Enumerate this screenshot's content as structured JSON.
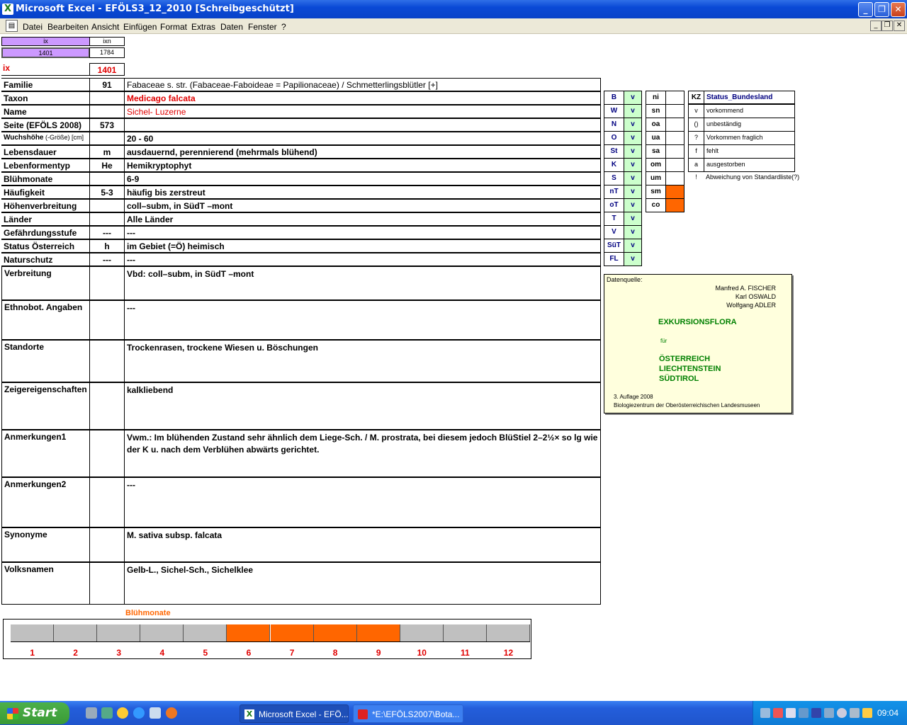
{
  "window": {
    "title": "Microsoft Excel - EFÖLS3_12_2010  [Schreibgeschützt]"
  },
  "menu": {
    "items": [
      "Datei",
      "Bearbeiten",
      "Ansicht",
      "Einfügen",
      "Format",
      "Extras",
      "Daten",
      "Fenster",
      "?"
    ]
  },
  "index": {
    "hdr_ix": "ix",
    "hdr_ixn": "ixn",
    "ix_val": "1401",
    "ixn_val": "1784",
    "ix_label": "ix",
    "ix_big": "1401"
  },
  "fields": [
    {
      "label": "Familie",
      "code": "91",
      "value": "Fabaceae s. str. (Fabaceae-Faboideae = Papilionaceae)  /  Schmetterlingsblütler [+]"
    },
    {
      "label": "Taxon",
      "code": "",
      "value": "Medicago falcata"
    },
    {
      "label": "Name",
      "code": "",
      "value": "Sichel- Luzerne"
    },
    {
      "label": "Seite (EFÖLS 2008)",
      "code": "573",
      "value": ""
    },
    {
      "label": "Wuchshöhe",
      "label_small": " (-Größe) [cm]",
      "code": "",
      "value": " 20 - 60"
    },
    {
      "label": "Lebensdauer",
      "code": "m",
      "value": "ausdauernd, perennierend (mehrmals blühend)"
    },
    {
      "label": "Lebenformentyp",
      "code": "He",
      "value": "Hemikryptophyt"
    },
    {
      "label": "Blühmonate",
      "code": "",
      "value": " 6-9"
    },
    {
      "label": "Häufigkeit",
      "code": "5-3",
      "value": "häufig bis zerstreut"
    },
    {
      "label": "Höhenverbreitung",
      "code": "",
      "value": "coll–subm, in SüdT –mont"
    },
    {
      "label": "Länder",
      "code": "",
      "value": "Alle Länder"
    },
    {
      "label": "Gefährdungsstufe",
      "code": "---",
      "value": "  ---"
    },
    {
      "label": "Status Österreich",
      "code": "h",
      "value": "im Gebiet (=Ö) heimisch"
    },
    {
      "label": "Naturschutz",
      "code": "---",
      "value": " ---"
    }
  ],
  "long_fields": [
    {
      "label": "Verbreitung",
      "value": "Vbd: coll–subm, in SüdT –mont"
    },
    {
      "label": "Ethnobot. Angaben",
      "value": "---"
    },
    {
      "label": "Standorte",
      "value": "Trockenrasen, trockene Wiesen u. Böschungen"
    },
    {
      "label": "Zeigereigenschaften",
      "value": "kalkliebend"
    },
    {
      "label": "Anmerkungen1",
      "value": "Vwm.: Im blühenden Zustand sehr ähnlich dem Liege-Sch. / M. prostrata, bei diesem jedoch BlüStiel 2–2½× so lg wie der K u. nach dem Verblühen abwärts gerichtet."
    },
    {
      "label": "Anmerkungen2",
      "value": "---"
    },
    {
      "label": "Synonyme",
      "value": "M. sativa subsp. falcata"
    },
    {
      "label": "Volksnamen",
      "value": "Gelb-L., Sichel-Sch., Sichelklee"
    }
  ],
  "regions": [
    {
      "code": "B",
      "status": "v"
    },
    {
      "code": "W",
      "status": "v"
    },
    {
      "code": "N",
      "status": "v"
    },
    {
      "code": "O",
      "status": "v"
    },
    {
      "code": "St",
      "status": "v"
    },
    {
      "code": "K",
      "status": "v"
    },
    {
      "code": "S",
      "status": "v"
    },
    {
      "code": "nT",
      "status": "v"
    },
    {
      "code": "oT",
      "status": "v"
    },
    {
      "code": "T",
      "status": "v"
    },
    {
      "code": "V",
      "status": "v"
    },
    {
      "code": "SüT",
      "status": "v"
    },
    {
      "code": "FL",
      "status": "v"
    }
  ],
  "altitudes": [
    {
      "code": "ni",
      "marked": false
    },
    {
      "code": "sn",
      "marked": false
    },
    {
      "code": "oa",
      "marked": false
    },
    {
      "code": "ua",
      "marked": false
    },
    {
      "code": "sa",
      "marked": false
    },
    {
      "code": "om",
      "marked": false
    },
    {
      "code": "um",
      "marked": false
    },
    {
      "code": "sm",
      "marked": true
    },
    {
      "code": "co",
      "marked": true
    }
  ],
  "legend": {
    "kz_header": "KZ",
    "status_header": "Status_Bundesland",
    "rows": [
      {
        "kz": "v",
        "text": "vorkommend"
      },
      {
        "kz": "()",
        "text": "unbeständig"
      },
      {
        "kz": "?",
        "text": "Vorkommen fraglich"
      },
      {
        "kz": "f",
        "text": "fehlt"
      },
      {
        "kz": "a",
        "text": "ausgestorben"
      },
      {
        "kz": "!",
        "text": "Abweichung von Standardliste(?)"
      }
    ]
  },
  "source": {
    "label": "Datenquelle:",
    "authors": [
      "Manfred A. FISCHER",
      "Karl OSWALD",
      "Wolfgang ADLER"
    ],
    "title": "EXKURSIONSFLORA",
    "fuer": "für",
    "countries": [
      "ÖSTERREICH",
      "LIECHTENSTEIN",
      "SÜDTIROL"
    ],
    "edition": "3. Auflage 2008",
    "publisher": "Biologiezentrum der Oberösterreichischen Landesmuseen"
  },
  "bloom": {
    "title": "Blühmonate",
    "months": [
      "1",
      "2",
      "3",
      "4",
      "5",
      "6",
      "7",
      "8",
      "9",
      "10",
      "11",
      "12"
    ],
    "active": [
      6,
      7,
      8,
      9
    ],
    "active_color": "#ff6600",
    "inactive_color": "#c0c0c0"
  },
  "taskbar": {
    "start": "Start",
    "tasks": [
      "Microsoft Excel - EFÖ...",
      "*E:\\EFÖLS2007\\Bota..."
    ],
    "clock": "09:04"
  },
  "colors": {
    "accent_orange": "#ff6600",
    "region_green": "#ccffcc",
    "note_yellow": "#ffffdd",
    "ix_purple": "#cc99ff",
    "red_text": "#e00000"
  }
}
